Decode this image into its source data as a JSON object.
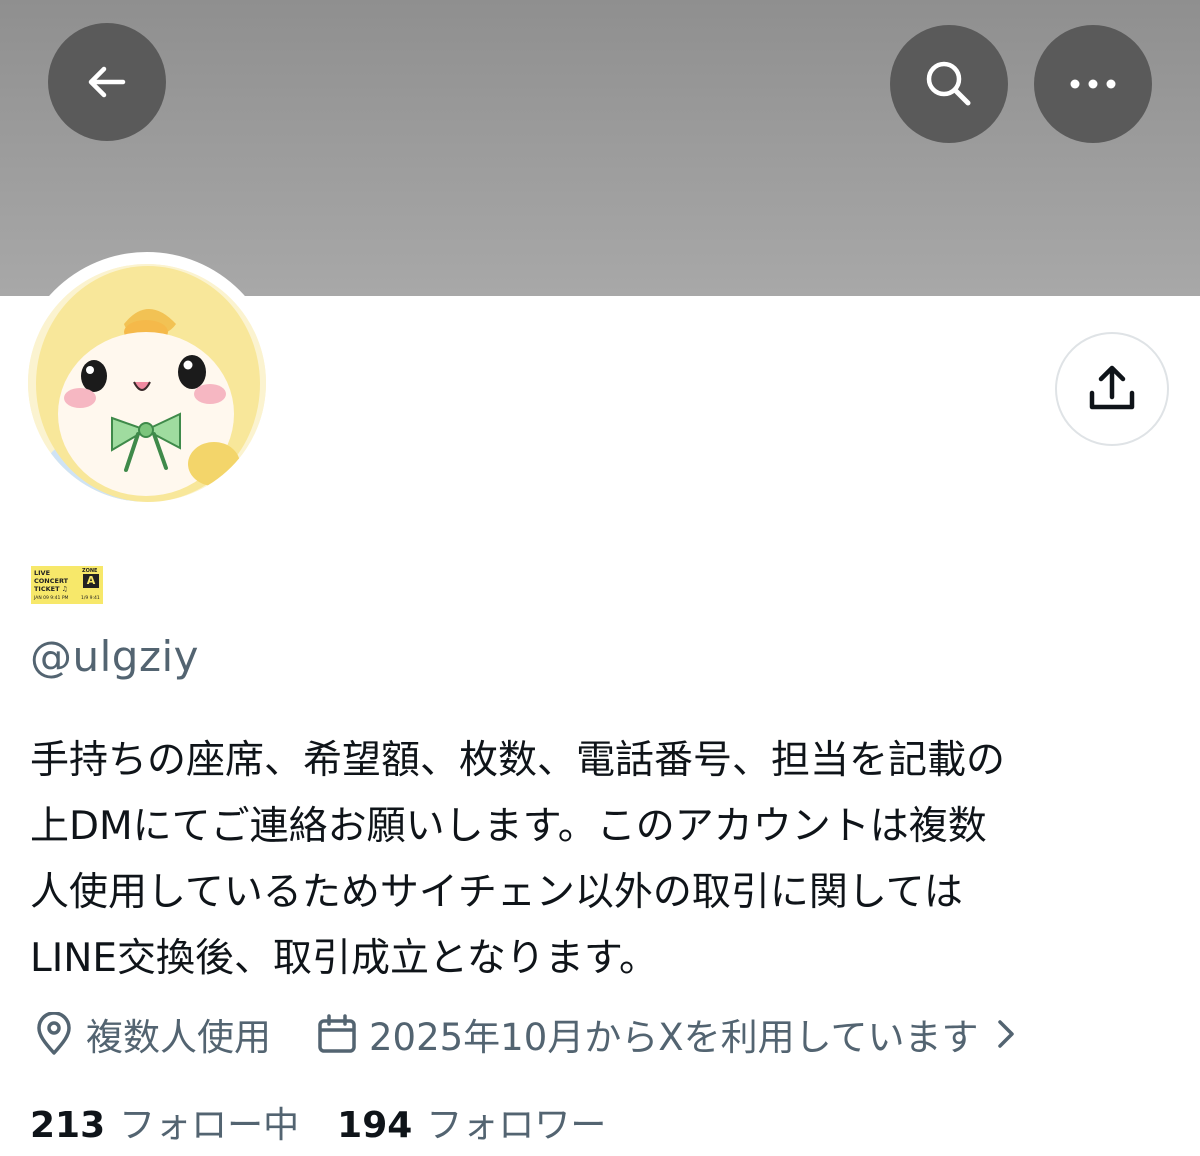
{
  "profile": {
    "handle": "@ulgziy",
    "bio": "手持ちの座席、希望額、枚数、電話番号、担当を記載の\n上DMにてご連絡お願いします。このアカウントは複数\n人使用しているためサイチェン以外の取引に関しては\nLINE交換後、取引成立となります。",
    "location": "複数人使用",
    "joined": "2025年10月からXを利用しています"
  },
  "badge": {
    "line1": "LIVE",
    "line2": "CONCERT",
    "line3": "TICKET ♫",
    "zone_label": "ZONE",
    "zone_letter": "A",
    "foot_left": "JAN 09   9:41 PM",
    "foot_right": "1/9  9:41"
  },
  "stats": {
    "following_count": "213",
    "following_label": "フォロー中",
    "followers_count": "194",
    "followers_label": "フォロワー"
  },
  "icons": {
    "back": "arrow-left-icon",
    "search": "search-icon",
    "more": "more-horizontal-icon",
    "share": "share-upload-icon",
    "location": "location-pin-icon",
    "calendar": "calendar-icon",
    "chevron": "chevron-right-icon"
  },
  "colors": {
    "banner": "#9a9a9a",
    "header_buttons": "#5a5a5a",
    "secondary_text": "#536471",
    "primary_text": "#0f1419",
    "badge_yellow": "#f7e86a"
  }
}
